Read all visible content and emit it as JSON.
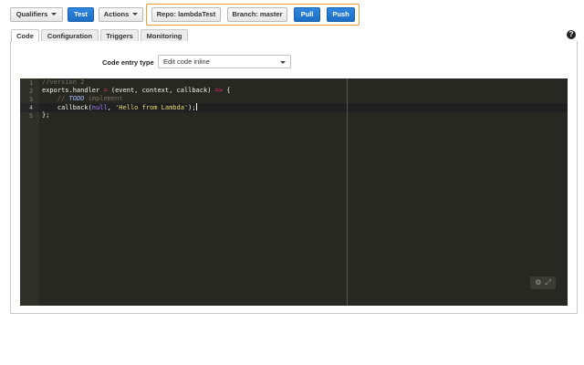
{
  "toolbar": {
    "qualifiers_label": "Qualifiers",
    "test_label": "Test",
    "actions_label": "Actions"
  },
  "git": {
    "repo_label": "Repo: lambdaTest",
    "branch_label": "Branch: master",
    "pull_label": "Pull",
    "push_label": "Push",
    "border_color": "#f0a030"
  },
  "tabs": [
    {
      "label": "Code",
      "active": true
    },
    {
      "label": "Configuration",
      "active": false
    },
    {
      "label": "Triggers",
      "active": false
    },
    {
      "label": "Monitoring",
      "active": false
    }
  ],
  "help_icon": "question-circle-icon",
  "code_entry": {
    "label": "Code entry type",
    "selected": "Edit code inline"
  },
  "editor": {
    "theme_bg": "#272822",
    "line_numbers": [
      "1",
      "2",
      "3",
      "4",
      "5"
    ],
    "lines": {
      "l1": "//version 2",
      "l2_a": "exports.handler ",
      "l2_op1": "=",
      "l2_b": " (event, context, callback) ",
      "l2_op2": "=>",
      "l2_c": " {",
      "l3_a": "    // ",
      "l3_todo": "TODO",
      "l3_b": " implement",
      "l4_a": "    callback(",
      "l4_null": "null",
      "l4_b": ", ",
      "l4_str": "'Hello from Lambda'",
      "l4_c": ");",
      "l5": "};"
    },
    "tool_icons": [
      "gear-icon",
      "expand-icon"
    ]
  }
}
